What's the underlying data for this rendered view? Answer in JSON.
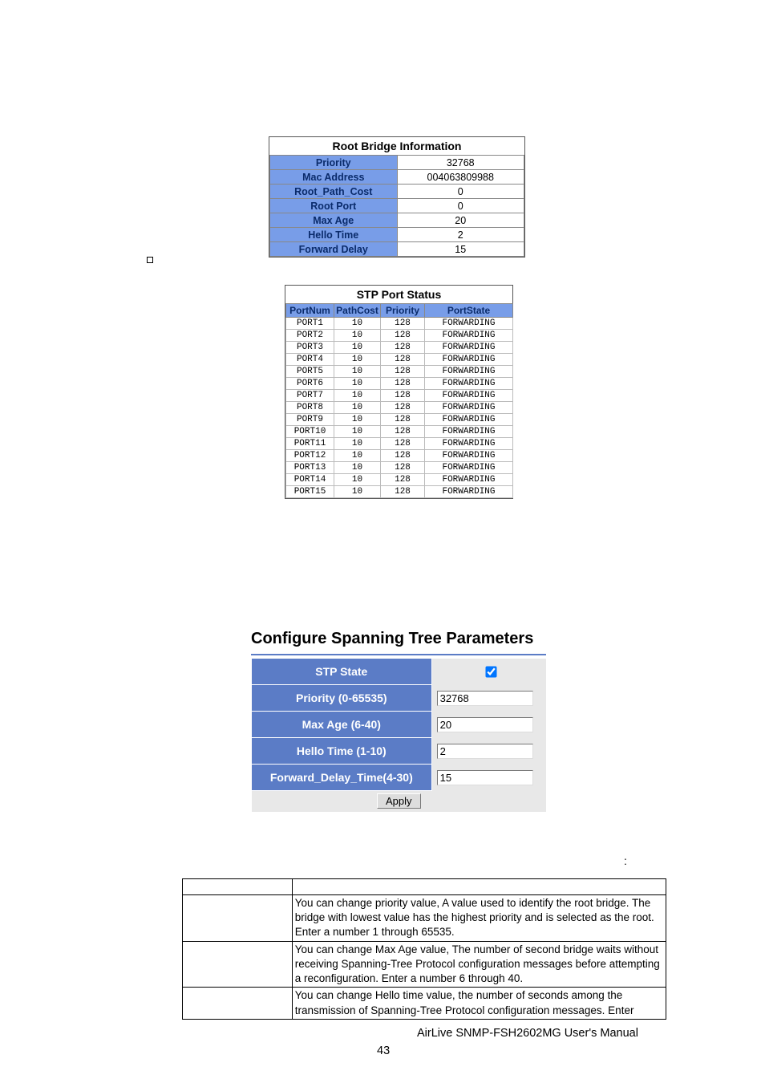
{
  "root_bridge": {
    "title": "Root Bridge Information",
    "rows": [
      {
        "k": "Priority",
        "v": "32768"
      },
      {
        "k": "Mac Address",
        "v": "004063809988"
      },
      {
        "k": "Root_Path_Cost",
        "v": "0"
      },
      {
        "k": "Root Port",
        "v": "0"
      },
      {
        "k": "Max Age",
        "v": "20"
      },
      {
        "k": "Hello Time",
        "v": "2"
      },
      {
        "k": "Forward Delay",
        "v": "15"
      }
    ]
  },
  "stp_port_status": {
    "title": "STP Port Status",
    "headers": [
      "PortNum",
      "PathCost",
      "Priority",
      "PortState"
    ],
    "rows": [
      [
        "PORT1",
        "10",
        "128",
        "FORWARDING"
      ],
      [
        "PORT2",
        "10",
        "128",
        "FORWARDING"
      ],
      [
        "PORT3",
        "10",
        "128",
        "FORWARDING"
      ],
      [
        "PORT4",
        "10",
        "128",
        "FORWARDING"
      ],
      [
        "PORT5",
        "10",
        "128",
        "FORWARDING"
      ],
      [
        "PORT6",
        "10",
        "128",
        "FORWARDING"
      ],
      [
        "PORT7",
        "10",
        "128",
        "FORWARDING"
      ],
      [
        "PORT8",
        "10",
        "128",
        "FORWARDING"
      ],
      [
        "PORT9",
        "10",
        "128",
        "FORWARDING"
      ],
      [
        "PORT10",
        "10",
        "128",
        "FORWARDING"
      ],
      [
        "PORT11",
        "10",
        "128",
        "FORWARDING"
      ],
      [
        "PORT12",
        "10",
        "128",
        "FORWARDING"
      ],
      [
        "PORT13",
        "10",
        "128",
        "FORWARDING"
      ],
      [
        "PORT14",
        "10",
        "128",
        "FORWARDING"
      ],
      [
        "PORT15",
        "10",
        "128",
        "FORWARDING"
      ]
    ]
  },
  "configure": {
    "title": "Configure Spanning Tree Parameters",
    "stp_state_label": "STP State",
    "stp_state_checked": true,
    "priority_label": "Priority (0-65535)",
    "priority_value": "32768",
    "max_age_label": "Max Age (6-40)",
    "max_age_value": "20",
    "hello_time_label": "Hello Time (1-10)",
    "hello_time_value": "2",
    "forward_delay_label": "Forward_Delay_Time(4-30)",
    "forward_delay_value": "15",
    "apply_label": "Apply"
  },
  "colon": ":",
  "descriptions": {
    "rows": [
      {
        "k": "",
        "v": ""
      },
      {
        "k": "",
        "v": "You can change priority value, A value used to identify the root bridge. The bridge with lowest value has the highest priority and is selected as the root. Enter a number 1 through 65535."
      },
      {
        "k": "",
        "v": "You can change Max Age value, The number of second bridge waits without receiving Spanning-Tree Protocol configuration messages before attempting a reconfiguration. Enter a number 6 through 40."
      },
      {
        "k": "",
        "v": "You can change Hello time value, the number of seconds among the transmission of Spanning-Tree Protocol configuration messages. Enter"
      }
    ]
  },
  "footer": "AirLive SNMP-FSH2602MG User's Manual",
  "page_number": "43"
}
